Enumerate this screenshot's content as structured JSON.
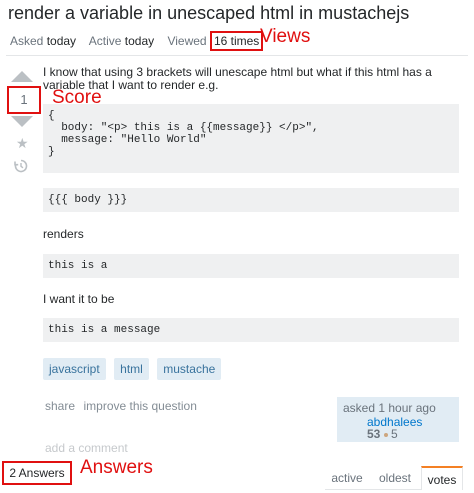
{
  "question": {
    "title": "render a variable in unescaped html in mustachejs",
    "asked_label": "Asked",
    "asked_value": "today",
    "active_label": "Active",
    "active_value": "today",
    "viewed_label": "Viewed",
    "viewed_value": "16 times",
    "score": "1",
    "body_intro": "I know that using 3 brackets will unescape html but what if this html has a variable that I want to render e.g.",
    "code_block_1": "{\n  body: \"<p> this is a {{message}} </p>\",\n  message: \"Hello World\"\n}",
    "code_block_2": "{{{ body }}}",
    "para_renders": "renders",
    "code_block_3": "this is a",
    "para_want": "I want it to be",
    "code_block_4": "this is a message",
    "tags": [
      "javascript",
      "html",
      "mustache"
    ],
    "share_label": "share",
    "improve_label": "improve this question",
    "asked_time": "asked 1 hour ago",
    "user_name": "abdhalees",
    "reputation": "53",
    "bronze_badges": "5",
    "add_comment": "add a comment"
  },
  "annotations": {
    "views": "Views",
    "score": "Score",
    "answers": "Answers"
  },
  "answers": {
    "count_label": "2 Answers",
    "sort_tabs": [
      "active",
      "oldest",
      "votes"
    ],
    "selected_tab": "votes"
  },
  "colors": {
    "annotation_red": "#e01010",
    "tag_bg": "#e1ecf4",
    "tag_text": "#39739d",
    "code_bg": "#eff0f1",
    "selected_tab_accent": "#f48024"
  },
  "icons": {
    "vote_up": "triangle-up",
    "vote_down": "triangle-down",
    "favorite": "star",
    "history": "history-clock",
    "badge": "bronze-dot"
  }
}
